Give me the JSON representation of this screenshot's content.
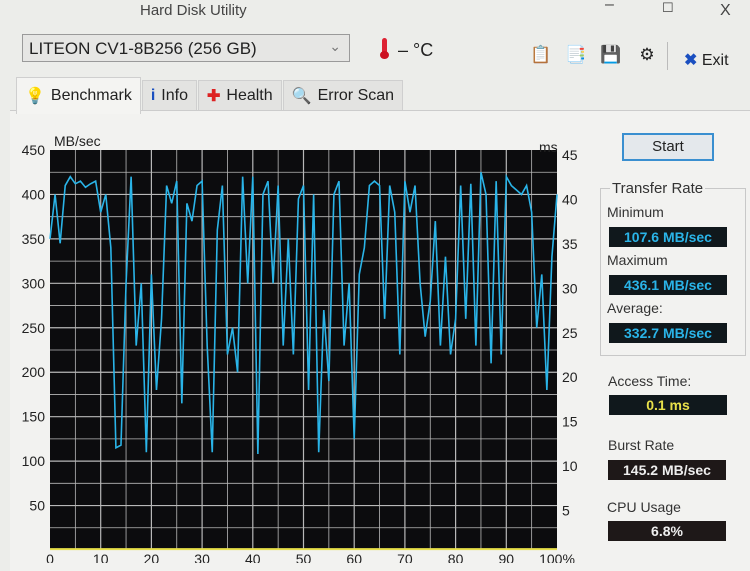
{
  "window": {
    "title": "Hard Disk Utility",
    "minimize": "–",
    "maximize": "☐",
    "close": "X"
  },
  "toolbar": {
    "drive": "LITEON  CV1-8B256 (256 GB)",
    "temperature": "– °C",
    "exit_label": "Exit",
    "icons": [
      "copy-text-icon",
      "copy-screenshot-icon",
      "save-icon",
      "options-icon"
    ]
  },
  "tabs": [
    {
      "label": "Benchmark",
      "icon": "bulb-icon",
      "active": true
    },
    {
      "label": "Info",
      "icon": "info-icon"
    },
    {
      "label": "Health",
      "icon": "health-cross-icon"
    },
    {
      "label": "Error Scan",
      "icon": "magnifier-icon"
    }
  ],
  "side": {
    "start_label": "Start",
    "transfer_rate": "Transfer Rate",
    "minimum_label": "Minimum",
    "minimum": "107.6 MB/sec",
    "maximum_label": "Maximum",
    "maximum": "436.1 MB/sec",
    "average_label": "Average:",
    "average": "332.7 MB/sec",
    "access_label": "Access Time:",
    "access": "0.1 ms",
    "burst_label": "Burst Rate",
    "burst": "145.2 MB/sec",
    "cpu_label": "CPU Usage",
    "cpu": "6.8%",
    "colors": {
      "transfer": "#2ab4e8",
      "access": "#e8e04a",
      "box": "#10181c"
    }
  },
  "chart_data": {
    "type": "line",
    "ylabel_left": "MB/sec",
    "ylabel_right": "ms",
    "ylim_left": [
      0,
      450
    ],
    "ylim_right": [
      0,
      45
    ],
    "xlim": [
      0,
      100
    ],
    "yticks_left": [
      "50",
      "100",
      "150",
      "200",
      "250",
      "300",
      "350",
      "400",
      "450"
    ],
    "yticks_right": [
      "5",
      "10",
      "15",
      "20",
      "25",
      "30",
      "35",
      "40",
      "45"
    ],
    "xticks": [
      "0",
      "10",
      "20",
      "30",
      "40",
      "50",
      "60",
      "70",
      "80",
      "90",
      "100%"
    ],
    "grid": true,
    "series": [
      {
        "color": "#2ab4e8",
        "x_step": 1,
        "values": [
          350,
          400,
          345,
          410,
          420,
          412,
          415,
          408,
          412,
          415,
          380,
          400,
          340,
          115,
          118,
          300,
          420,
          230,
          300,
          110,
          310,
          180,
          260,
          410,
          390,
          415,
          165,
          390,
          370,
          410,
          415,
          230,
          110,
          360,
          410,
          220,
          250,
          200,
          420,
          300,
          420,
          108,
          400,
          415,
          300,
          410,
          230,
          350,
          220,
          395,
          410,
          180,
          400,
          110,
          270,
          190,
          400,
          415,
          230,
          300,
          125,
          310,
          340,
          410,
          415,
          410,
          260,
          410,
          380,
          220,
          415,
          380,
          410,
          300,
          240,
          280,
          370,
          230,
          330,
          220,
          260,
          410,
          260,
          412,
          230,
          425,
          400,
          210,
          415,
          220,
          420,
          410,
          405,
          400,
          410,
          380,
          250,
          310,
          180,
          330,
          400
        ]
      },
      {
        "color": "#e8e04a",
        "x_step": 10,
        "values": [
          0.1,
          0.1,
          0.1,
          0.1,
          0.1,
          0.1,
          0.1,
          0.1,
          0.1,
          0.1,
          0.1
        ]
      }
    ]
  }
}
